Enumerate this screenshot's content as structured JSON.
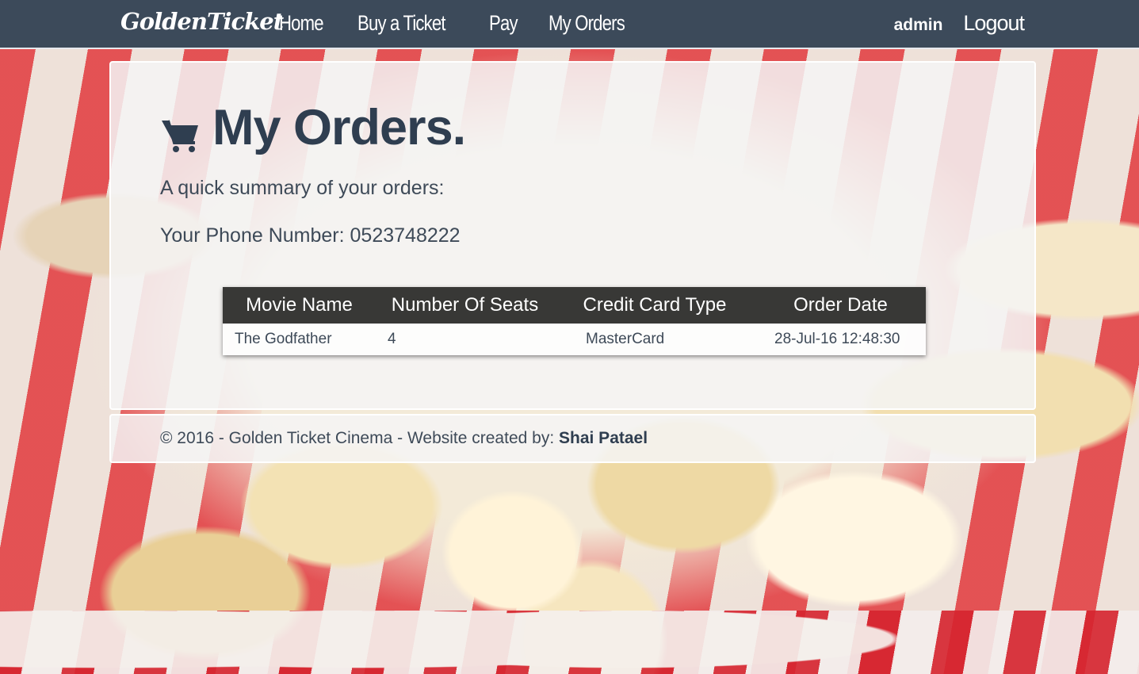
{
  "navbar": {
    "brand": "GoldenTicket",
    "links": [
      {
        "label": "Home"
      },
      {
        "label": "Buy a Ticket"
      },
      {
        "label": "Pay"
      },
      {
        "label": "My Orders"
      }
    ],
    "user": "admin",
    "logout_label": "Logout"
  },
  "main": {
    "title": "My Orders.",
    "title_icon": "shopping-cart-icon",
    "summary": "A quick summary of your orders:",
    "phone_label": "Your Phone Number:",
    "phone_number": "0523748222",
    "table": {
      "headers": [
        "Movie Name",
        "Number Of Seats",
        "Credit Card Type",
        "Order Date"
      ],
      "rows": [
        [
          "The Godfather",
          "4",
          "MasterCard",
          "28-Jul-16 12:48:30"
        ]
      ]
    }
  },
  "footer": {
    "text": "© 2016 - Golden Ticket Cinema - Website created by:",
    "author": "Shai Patael"
  },
  "colors": {
    "navbar_bg": "#3c4a5a",
    "title_text": "#2f3e50",
    "table_header_bg": "#383836"
  }
}
